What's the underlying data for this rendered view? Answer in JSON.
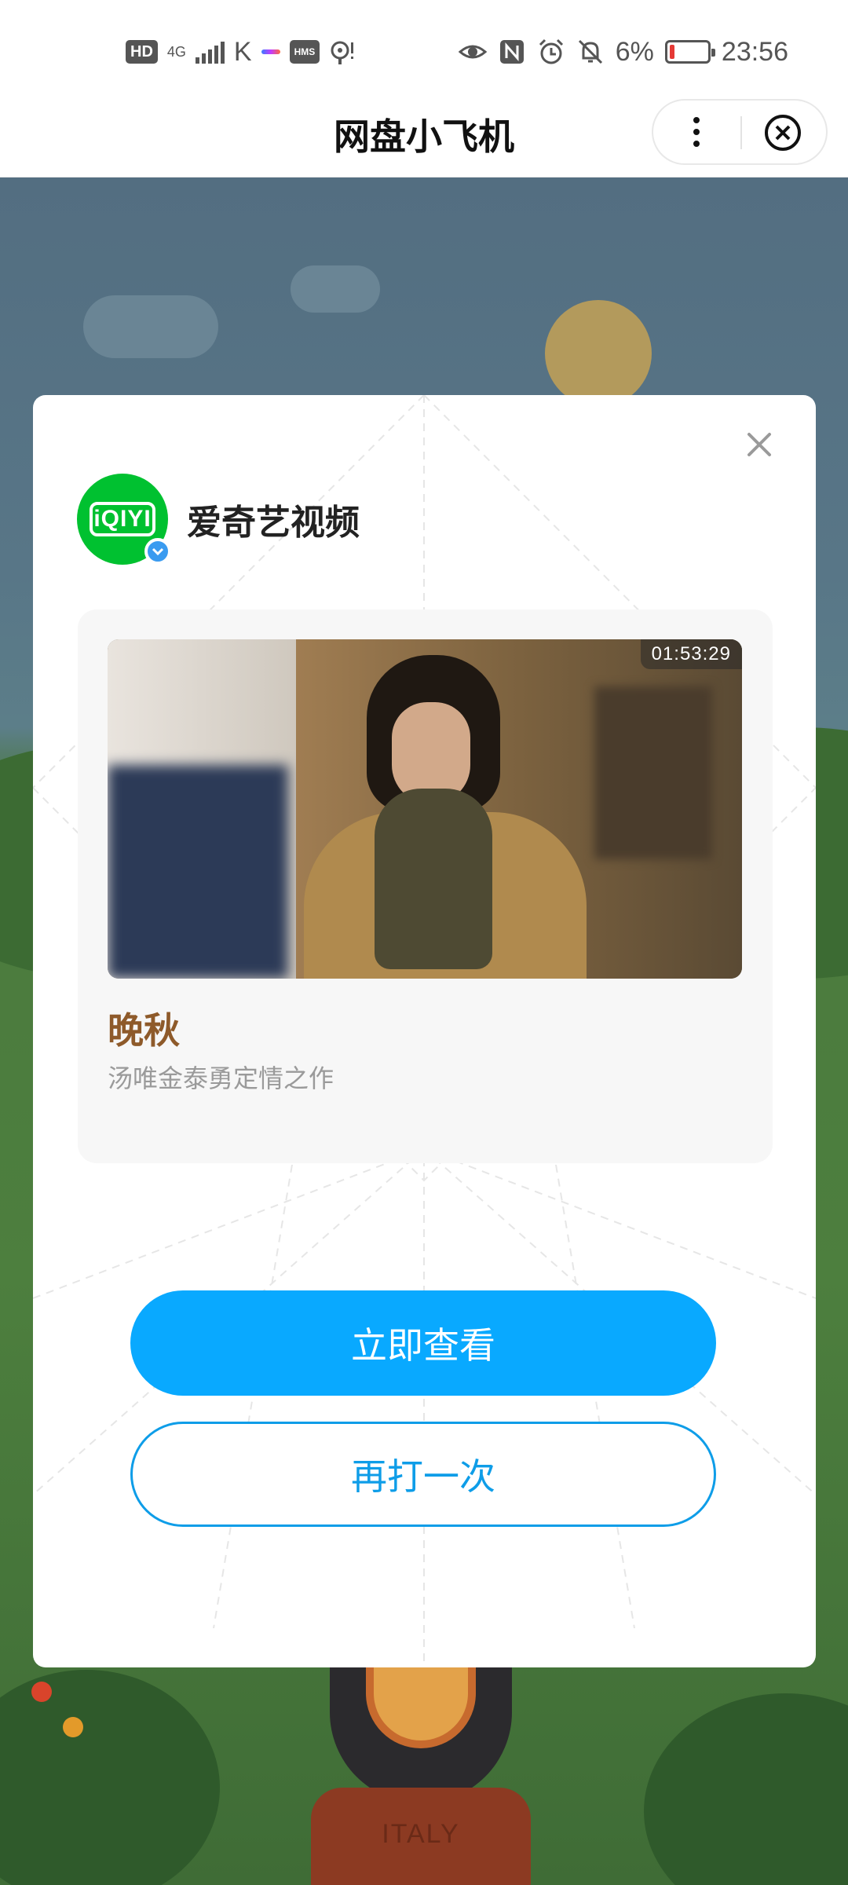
{
  "status_bar": {
    "hd_label": "HD",
    "network_label": "4G",
    "hms_label": "HMS",
    "battery_percent": "6%",
    "time": "23:56",
    "battery_level": 0.06,
    "icons": [
      "eye-icon",
      "nfc-icon",
      "alarm-icon",
      "bell-off-icon",
      "battery-icon"
    ]
  },
  "nav": {
    "title": "网盘小飞机",
    "more_icon": "more-vertical-icon",
    "close_icon": "close-circle-icon"
  },
  "modal": {
    "close_icon": "close-icon",
    "brand": {
      "logo_text": "iQIYI",
      "name": "爱奇艺视频",
      "verified_icon": "check-badge-icon"
    },
    "video": {
      "duration": "01:53:29",
      "title": "晚秋",
      "description": "汤唯金泰勇定情之作"
    },
    "primary_button": "立即查看",
    "secondary_button": "再打一次"
  },
  "background": {
    "pedestal_text": "ITALY"
  },
  "colors": {
    "accent": "#09a9ff",
    "title_brown": "#8e5a2a",
    "iqiyi_green": "#00c130"
  }
}
